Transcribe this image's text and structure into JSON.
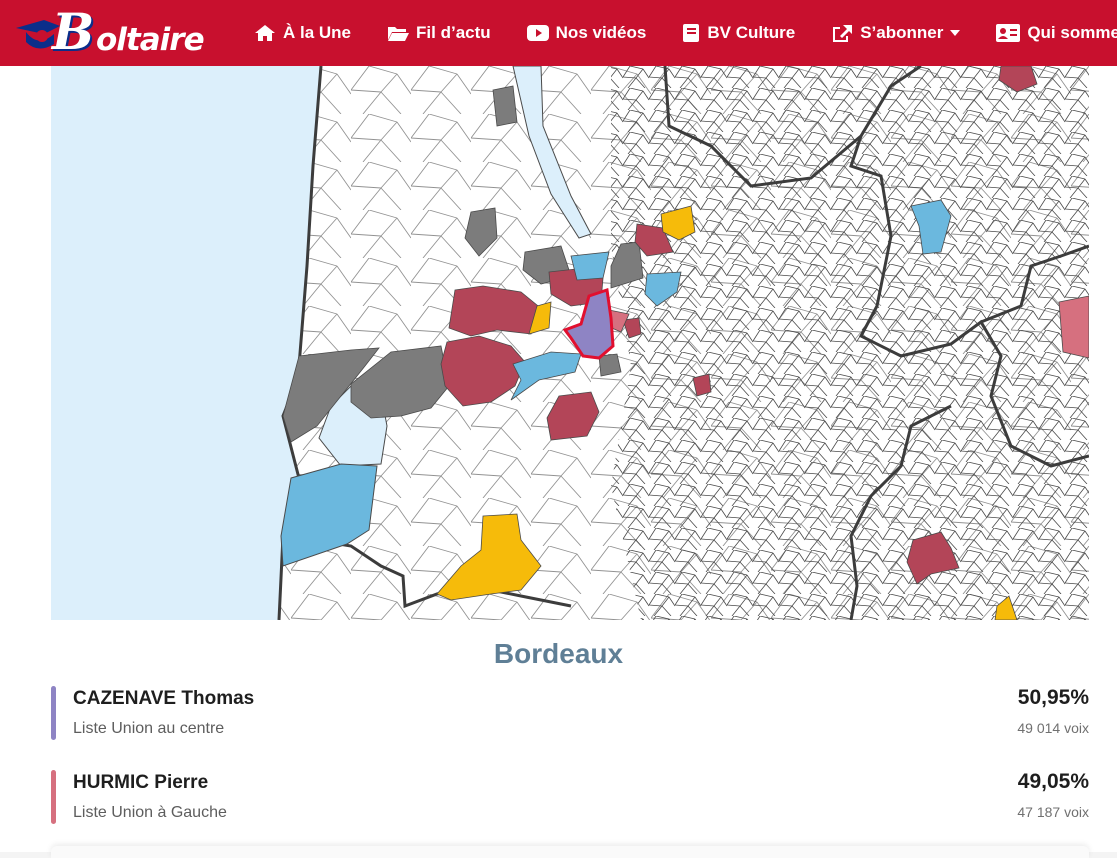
{
  "header": {
    "logo_text": "oltaire",
    "logo_letter": "B",
    "nav": [
      {
        "label": "À la Une",
        "icon": "home-icon"
      },
      {
        "label": "Fil d’actu",
        "icon": "folder-open-icon"
      },
      {
        "label": "Nos vidéos",
        "icon": "youtube-icon"
      },
      {
        "label": "BV Culture",
        "icon": "book-icon"
      },
      {
        "label": "S’abonner",
        "icon": "share-icon",
        "has_dropdown": true
      },
      {
        "label": "Qui sommes-n",
        "icon": "id-card-icon"
      }
    ]
  },
  "colors": {
    "brand_red": "#c8102e",
    "centre": "#8e84c4",
    "gauche": "#b34558",
    "gauche_light": "#d6707f",
    "blue": "#6bb8de",
    "yellow": "#f6bb0a",
    "gray": "#7c7c7c",
    "sea": "#dceffb"
  },
  "map": {
    "selected_commune": "Bordeaux"
  },
  "result": {
    "city": "Bordeaux",
    "candidates": [
      {
        "name": "CAZENAVE Thomas",
        "list": "Liste Union au centre",
        "pct": "50,95%",
        "votes": "49 014 voix",
        "color": "#8e84c4"
      },
      {
        "name": "HURMIC Pierre",
        "list": "Liste Union à Gauche",
        "pct": "49,05%",
        "votes": "47 187 voix",
        "color": "#d6707f"
      }
    ]
  }
}
